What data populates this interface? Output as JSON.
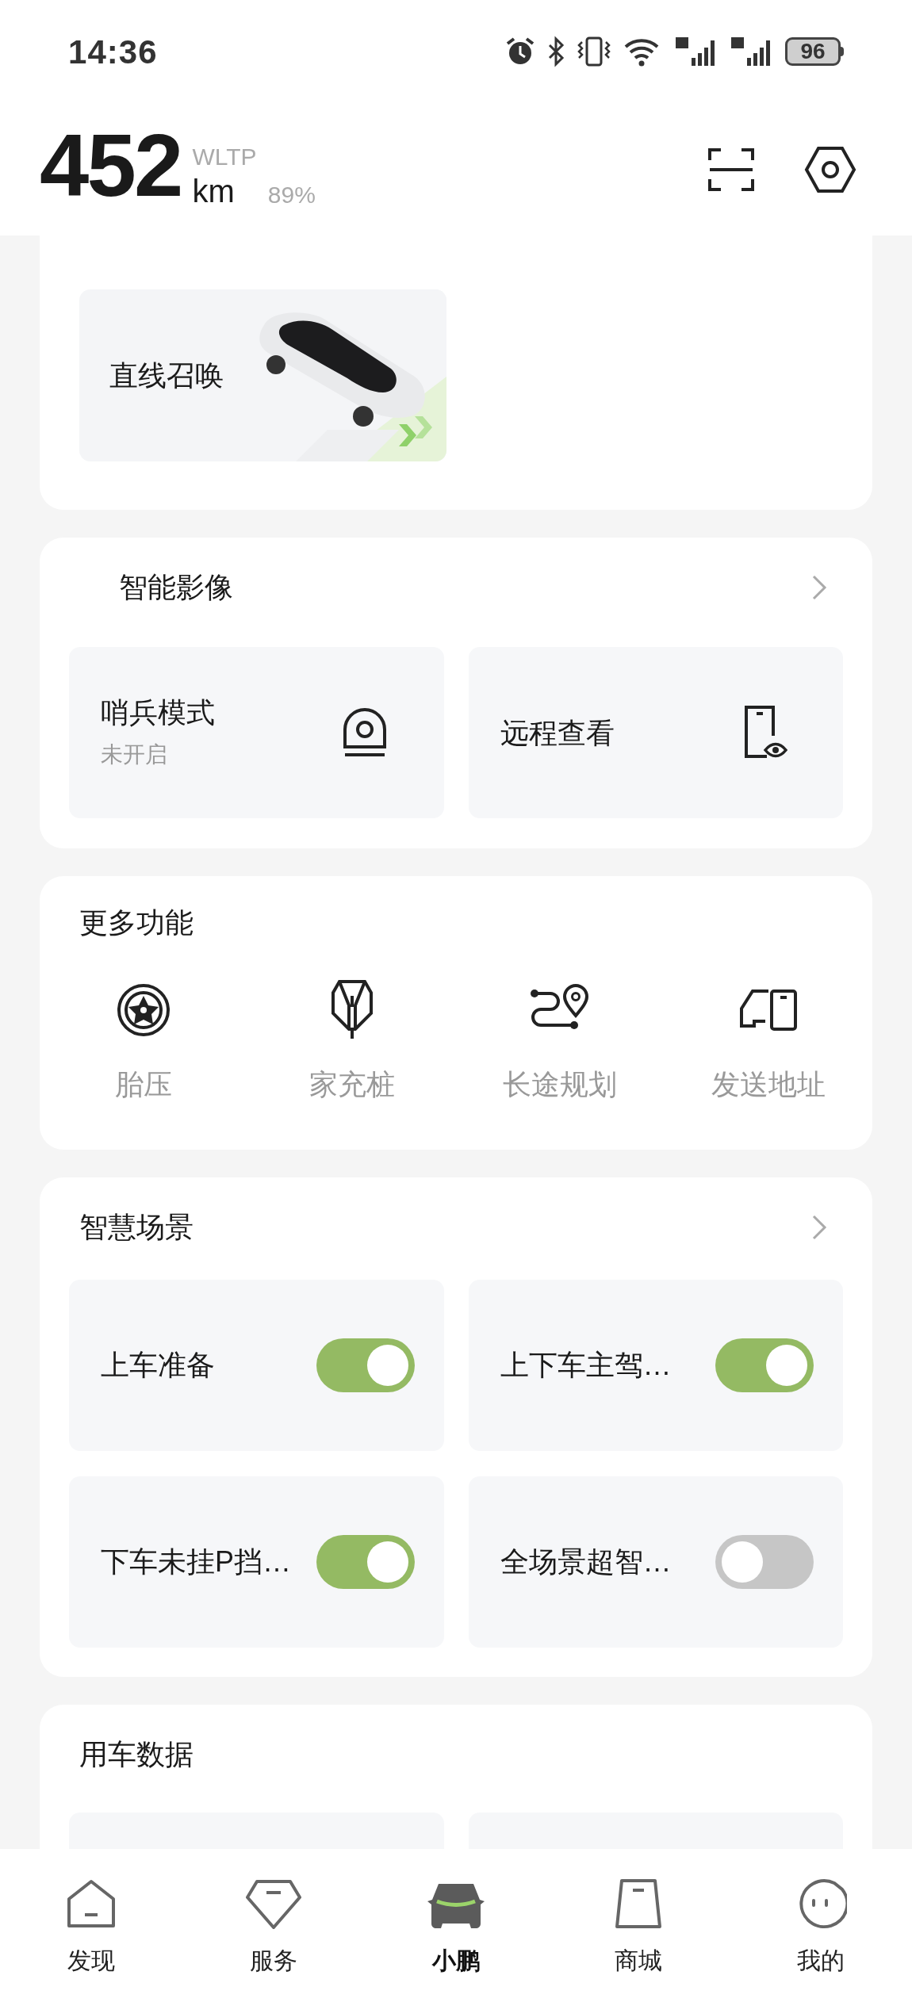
{
  "status_bar": {
    "time": "14:36",
    "battery": "96"
  },
  "header": {
    "range": "452",
    "unit": "km",
    "standard": "WLTP",
    "battery_percent": "89%"
  },
  "parking": {
    "tiles": [
      {
        "label": "直线召唤",
        "kind": "picture"
      }
    ]
  },
  "imaging": {
    "title": "智能影像",
    "tiles": [
      {
        "label": "哨兵模式",
        "sub": "未开启",
        "kind": "sentry"
      },
      {
        "label": "远程查看",
        "kind": "remote"
      }
    ]
  },
  "more_functions": {
    "title": "更多功能",
    "items": [
      {
        "label": "胎压",
        "kind": "tire"
      },
      {
        "label": "家充桩",
        "kind": "charger"
      },
      {
        "label": "长途规划",
        "kind": "route"
      },
      {
        "label": "发送地址",
        "kind": "send"
      }
    ]
  },
  "scenes": {
    "title": "智慧场景",
    "items": [
      {
        "label": "上车准备",
        "on": true
      },
      {
        "label": "上下车主驾…",
        "on": true
      },
      {
        "label": "下车未挂P挡…",
        "on": true
      },
      {
        "label": "全场景超智…",
        "on": false
      }
    ]
  },
  "usage": {
    "title": "用车数据"
  },
  "nav": {
    "items": [
      {
        "label": "发现",
        "kind": "home",
        "selected": false
      },
      {
        "label": "服务",
        "kind": "gem",
        "selected": false
      },
      {
        "label": "小鹏",
        "kind": "car",
        "selected": true
      },
      {
        "label": "商城",
        "kind": "bag",
        "selected": false
      },
      {
        "label": "我的",
        "kind": "face",
        "selected": false
      }
    ]
  }
}
